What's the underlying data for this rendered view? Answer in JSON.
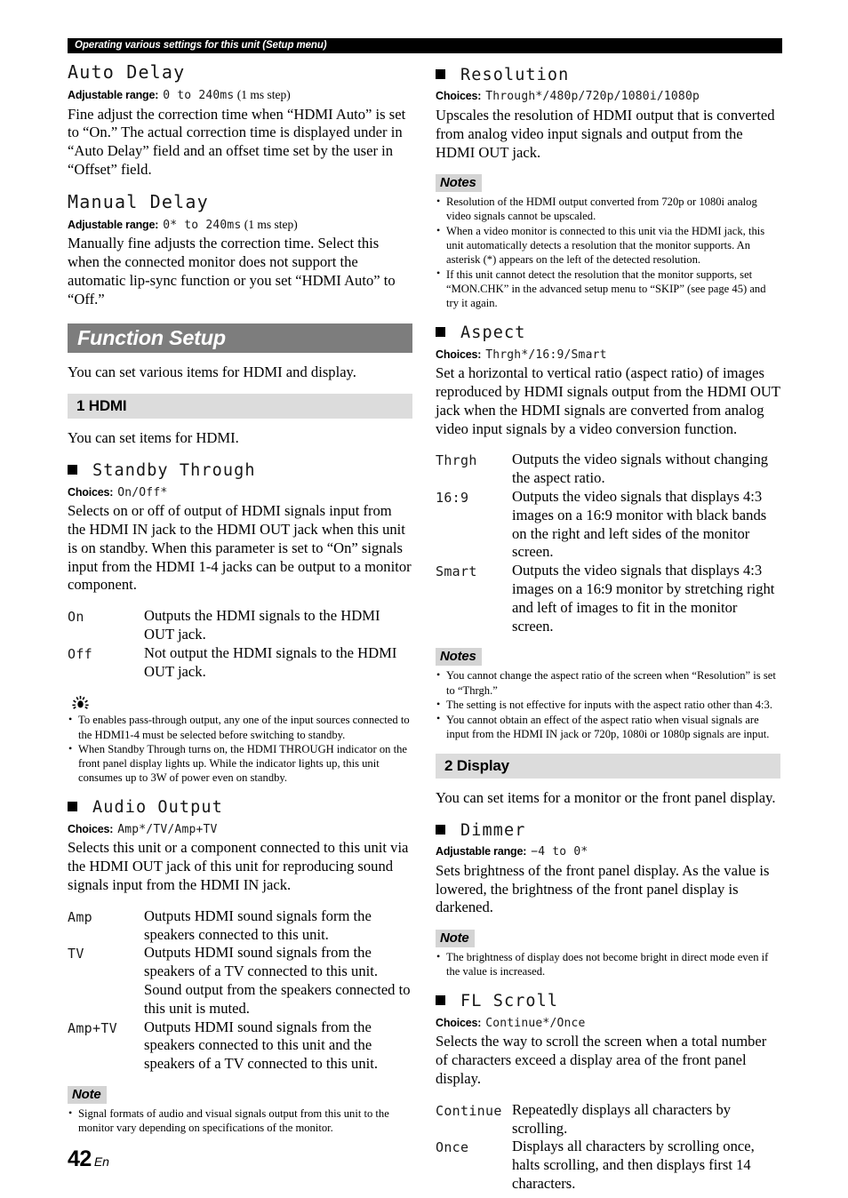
{
  "page": {
    "running_header": "Operating various settings for this unit (Setup menu)",
    "folio_number": "42",
    "folio_lang": "En"
  },
  "colors": {
    "header_bar_bg": "#000000",
    "banner_bg": "#7d7d7d",
    "subbanner_bg": "#dcdcdc",
    "note_badge_bg": "#d4d4d4",
    "text": "#000000"
  },
  "labels": {
    "choices": "Choices:",
    "adjustable_range": "Adjustable range:",
    "note": "Note",
    "notes": "Notes"
  },
  "left_column": {
    "auto_delay": {
      "title": "Auto Delay",
      "range_value": "0 to 240ms",
      "range_tail": "(1 ms step)",
      "body": "Fine adjust the correction time when “HDMI Auto” is set to “On.” The actual correction time is displayed under in “Auto Delay” field and an offset time set by the user in “Offset” field."
    },
    "manual_delay": {
      "title": "Manual Delay",
      "range_value": "0* to 240ms",
      "range_tail": "(1 ms step)",
      "body": "Manually fine adjusts the correction time. Select this when the connected monitor does not support the automatic lip-sync function or you set “HDMI Auto” to “Off.”"
    },
    "function_setup": {
      "banner": "Function Setup",
      "intro": "You can set various items for HDMI and display."
    },
    "hdmi": {
      "subbanner": "1 HDMI",
      "intro": "You can set items for HDMI."
    },
    "standby_through": {
      "name": "Standby Through",
      "choices": "On/Off*",
      "body": "Selects on or off of output of HDMI signals input from the HDMI IN jack to the HDMI OUT jack when this unit is on standby. When this parameter is set to “On” signals input from the HDMI 1-4 jacks can be output to a monitor component.",
      "definitions": [
        {
          "term": "On",
          "desc": "Outputs the HDMI signals to the HDMI OUT jack."
        },
        {
          "term": "Off",
          "desc": "Not output the HDMI signals to the HDMI OUT jack."
        }
      ],
      "tips": [
        "To enables pass-through output, any one of the input sources connected to the HDMI1-4 must be selected before switching to standby.",
        "When Standby Through turns on, the HDMI THROUGH indicator on the front panel display lights up. While the indicator lights up, this unit consumes up to 3W of power even on standby."
      ]
    },
    "audio_output": {
      "name": "Audio Output",
      "choices": "Amp*/TV/Amp+TV",
      "body": "Selects this unit or a component connected to this unit via the HDMI OUT jack of this unit for reproducing sound signals input from the HDMI IN jack.",
      "definitions": [
        {
          "term": "Amp",
          "desc": "Outputs HDMI sound signals form the speakers connected to this unit."
        },
        {
          "term": "TV",
          "desc": "Outputs HDMI sound signals from the speakers of a TV connected to this unit. Sound output from the speakers connected to this unit is muted."
        },
        {
          "term": "Amp+TV",
          "desc": "Outputs HDMI sound signals from the speakers connected to this unit and the speakers of a TV connected to this unit."
        }
      ],
      "notes": [
        "Signal formats of audio and visual signals output from this unit to the monitor vary depending on specifications of the monitor."
      ]
    }
  },
  "right_column": {
    "resolution": {
      "name": "Resolution",
      "choices": "Through*/480p/720p/1080i/1080p",
      "body": "Upscales the resolution of HDMI output that is converted from analog video input signals and output from the HDMI OUT jack.",
      "notes": [
        "Resolution of the HDMI output converted from 720p or 1080i analog video signals cannot be upscaled.",
        "When a video monitor is connected to this unit via the HDMI jack, this unit automatically detects a resolution that the monitor supports. An asterisk (*) appears on the left of the detected resolution.",
        "If this unit cannot detect the resolution that the monitor supports, set “MON.CHK” in the advanced setup menu to “SKIP” (see page 45) and try it again."
      ]
    },
    "aspect": {
      "name": "Aspect",
      "choices": "Thrgh*/16:9/Smart",
      "body": "Set a horizontal to vertical ratio (aspect ratio) of images reproduced by HDMI signals output from the HDMI OUT jack when the HDMI signals are converted from analog video input signals by a video conversion function.",
      "definitions": [
        {
          "term": "Thrgh",
          "desc": "Outputs the video signals without changing the aspect ratio."
        },
        {
          "term": "16:9",
          "desc": "Outputs the video signals that displays 4:3 images on a 16:9 monitor with black bands on the right and left sides of the monitor screen."
        },
        {
          "term": "Smart",
          "desc": "Outputs the video signals that displays 4:3 images on a 16:9 monitor by stretching right and left of images to fit in the monitor screen."
        }
      ],
      "notes": [
        "You cannot change the aspect ratio of the screen when “Resolution” is set to “Thrgh.”",
        "The setting is not effective for inputs with the aspect ratio other than 4:3.",
        "You cannot obtain an effect of the aspect ratio when visual signals are input from the HDMI IN jack or 720p, 1080i or 1080p signals are input."
      ]
    },
    "display": {
      "subbanner": "2 Display",
      "intro": "You can set items for a monitor or the front panel display."
    },
    "dimmer": {
      "name": "Dimmer",
      "range_value": "−4 to 0*",
      "body": "Sets brightness of the front panel display. As the value is lowered, the brightness of the front panel display is darkened.",
      "notes": [
        "The brightness of display does not become bright in direct mode even if the value is increased."
      ]
    },
    "fl_scroll": {
      "name": "FL Scroll",
      "choices": "Continue*/Once",
      "body": "Selects the way to scroll the screen when a total number of characters exceed a display area of the front panel display.",
      "definitions": [
        {
          "term": "Continue",
          "desc": "Repeatedly displays all characters by scrolling."
        },
        {
          "term": "Once",
          "desc": "Displays all characters by scrolling once, halts scrolling, and then displays first 14 characters."
        }
      ]
    }
  }
}
